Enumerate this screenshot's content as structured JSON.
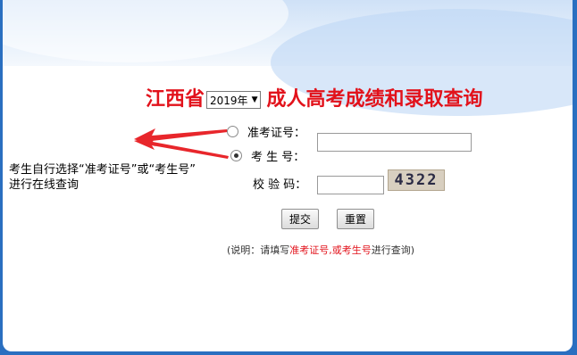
{
  "title": {
    "prefix": "江西省",
    "year": "2019年",
    "suffix": "成人高考成绩和录取查询"
  },
  "form": {
    "exam_cert_label": "准考证号：",
    "exam_cert_selected": false,
    "student_no_label": "考 生 号：",
    "student_no_selected": true,
    "captcha_label": "校 验 码：",
    "captcha_text": "4322",
    "exam_cert_value": "",
    "captcha_value": ""
  },
  "buttons": {
    "submit": "提交",
    "reset": "重置"
  },
  "note": {
    "prefix": "(说明：请填写",
    "highlight": "准考证号,或考生号",
    "suffix": "进行查询)"
  },
  "annotation": {
    "line1": "考生自行选择“准考证号”或“考生号”",
    "line2": "进行在线查询"
  },
  "colors": {
    "title_red": "#e2121b",
    "arrow_red": "#e8262b"
  }
}
